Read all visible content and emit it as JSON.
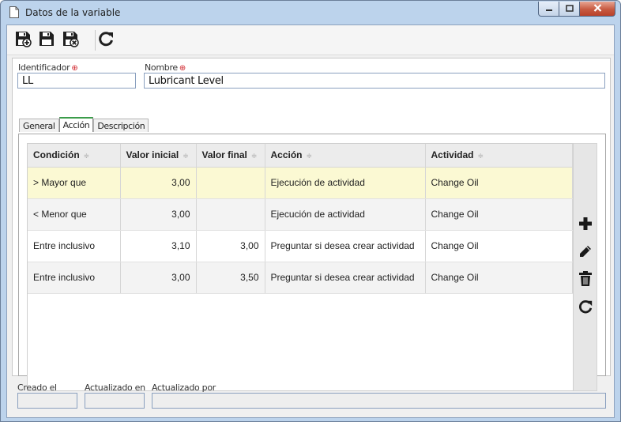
{
  "window": {
    "title": "Datos de la variable",
    "controls": [
      "minimize-icon",
      "maximize-icon",
      "close-icon"
    ]
  },
  "toolbar": {
    "buttons": [
      {
        "name": "save-new-button",
        "icon": "save-new-icon"
      },
      {
        "name": "save-button",
        "icon": "save-icon"
      },
      {
        "name": "save-close-button",
        "icon": "save-close-icon"
      },
      {
        "name": "refresh-button",
        "icon": "refresh-icon"
      }
    ]
  },
  "form": {
    "identificador": {
      "label": "Identificador",
      "value": "LL",
      "required": true
    },
    "nombre": {
      "label": "Nombre",
      "value": "Lubricant Level",
      "required": true
    },
    "required_marker": "⊕"
  },
  "tabs": [
    {
      "label": "General",
      "active": false
    },
    {
      "label": "Acción",
      "active": true
    },
    {
      "label": "Descripción",
      "active": false
    }
  ],
  "grid": {
    "columns": [
      "Condición",
      "Valor inicial",
      "Valor final",
      "Acción",
      "Actividad"
    ],
    "sort_glyph": "≑",
    "rows": [
      {
        "condicion": "> Mayor que",
        "valor_inicial": "3,00",
        "valor_final": "",
        "accion": "Ejecución de actividad",
        "actividad": "Change Oil",
        "selected": true
      },
      {
        "condicion": "< Menor que",
        "valor_inicial": "3,00",
        "valor_final": "",
        "accion": "Ejecución de actividad",
        "actividad": "Change Oil",
        "selected": false
      },
      {
        "condicion": "Entre inclusivo",
        "valor_inicial": "3,10",
        "valor_final": "3,00",
        "accion": "Preguntar si desea crear actividad",
        "actividad": "Change Oil",
        "selected": false
      },
      {
        "condicion": "Entre inclusivo",
        "valor_inicial": "3,00",
        "valor_final": "3,50",
        "accion": "Preguntar si desea crear actividad",
        "actividad": "Change Oil",
        "selected": false
      }
    ],
    "side_actions": [
      "add-icon",
      "edit-icon",
      "delete-icon",
      "refresh-icon"
    ]
  },
  "footer": {
    "creado_el": {
      "label": "Creado el",
      "value": ""
    },
    "actualizado_en": {
      "label": "Actualizado en",
      "value": ""
    },
    "actualizado_por": {
      "label": "Actualizado por",
      "value": ""
    }
  },
  "colors": {
    "window_frame": "#bcd3ec",
    "selected_row": "#fbf9d3",
    "required": "#d0242b",
    "active_tab_accent": "#3b9c4a"
  }
}
